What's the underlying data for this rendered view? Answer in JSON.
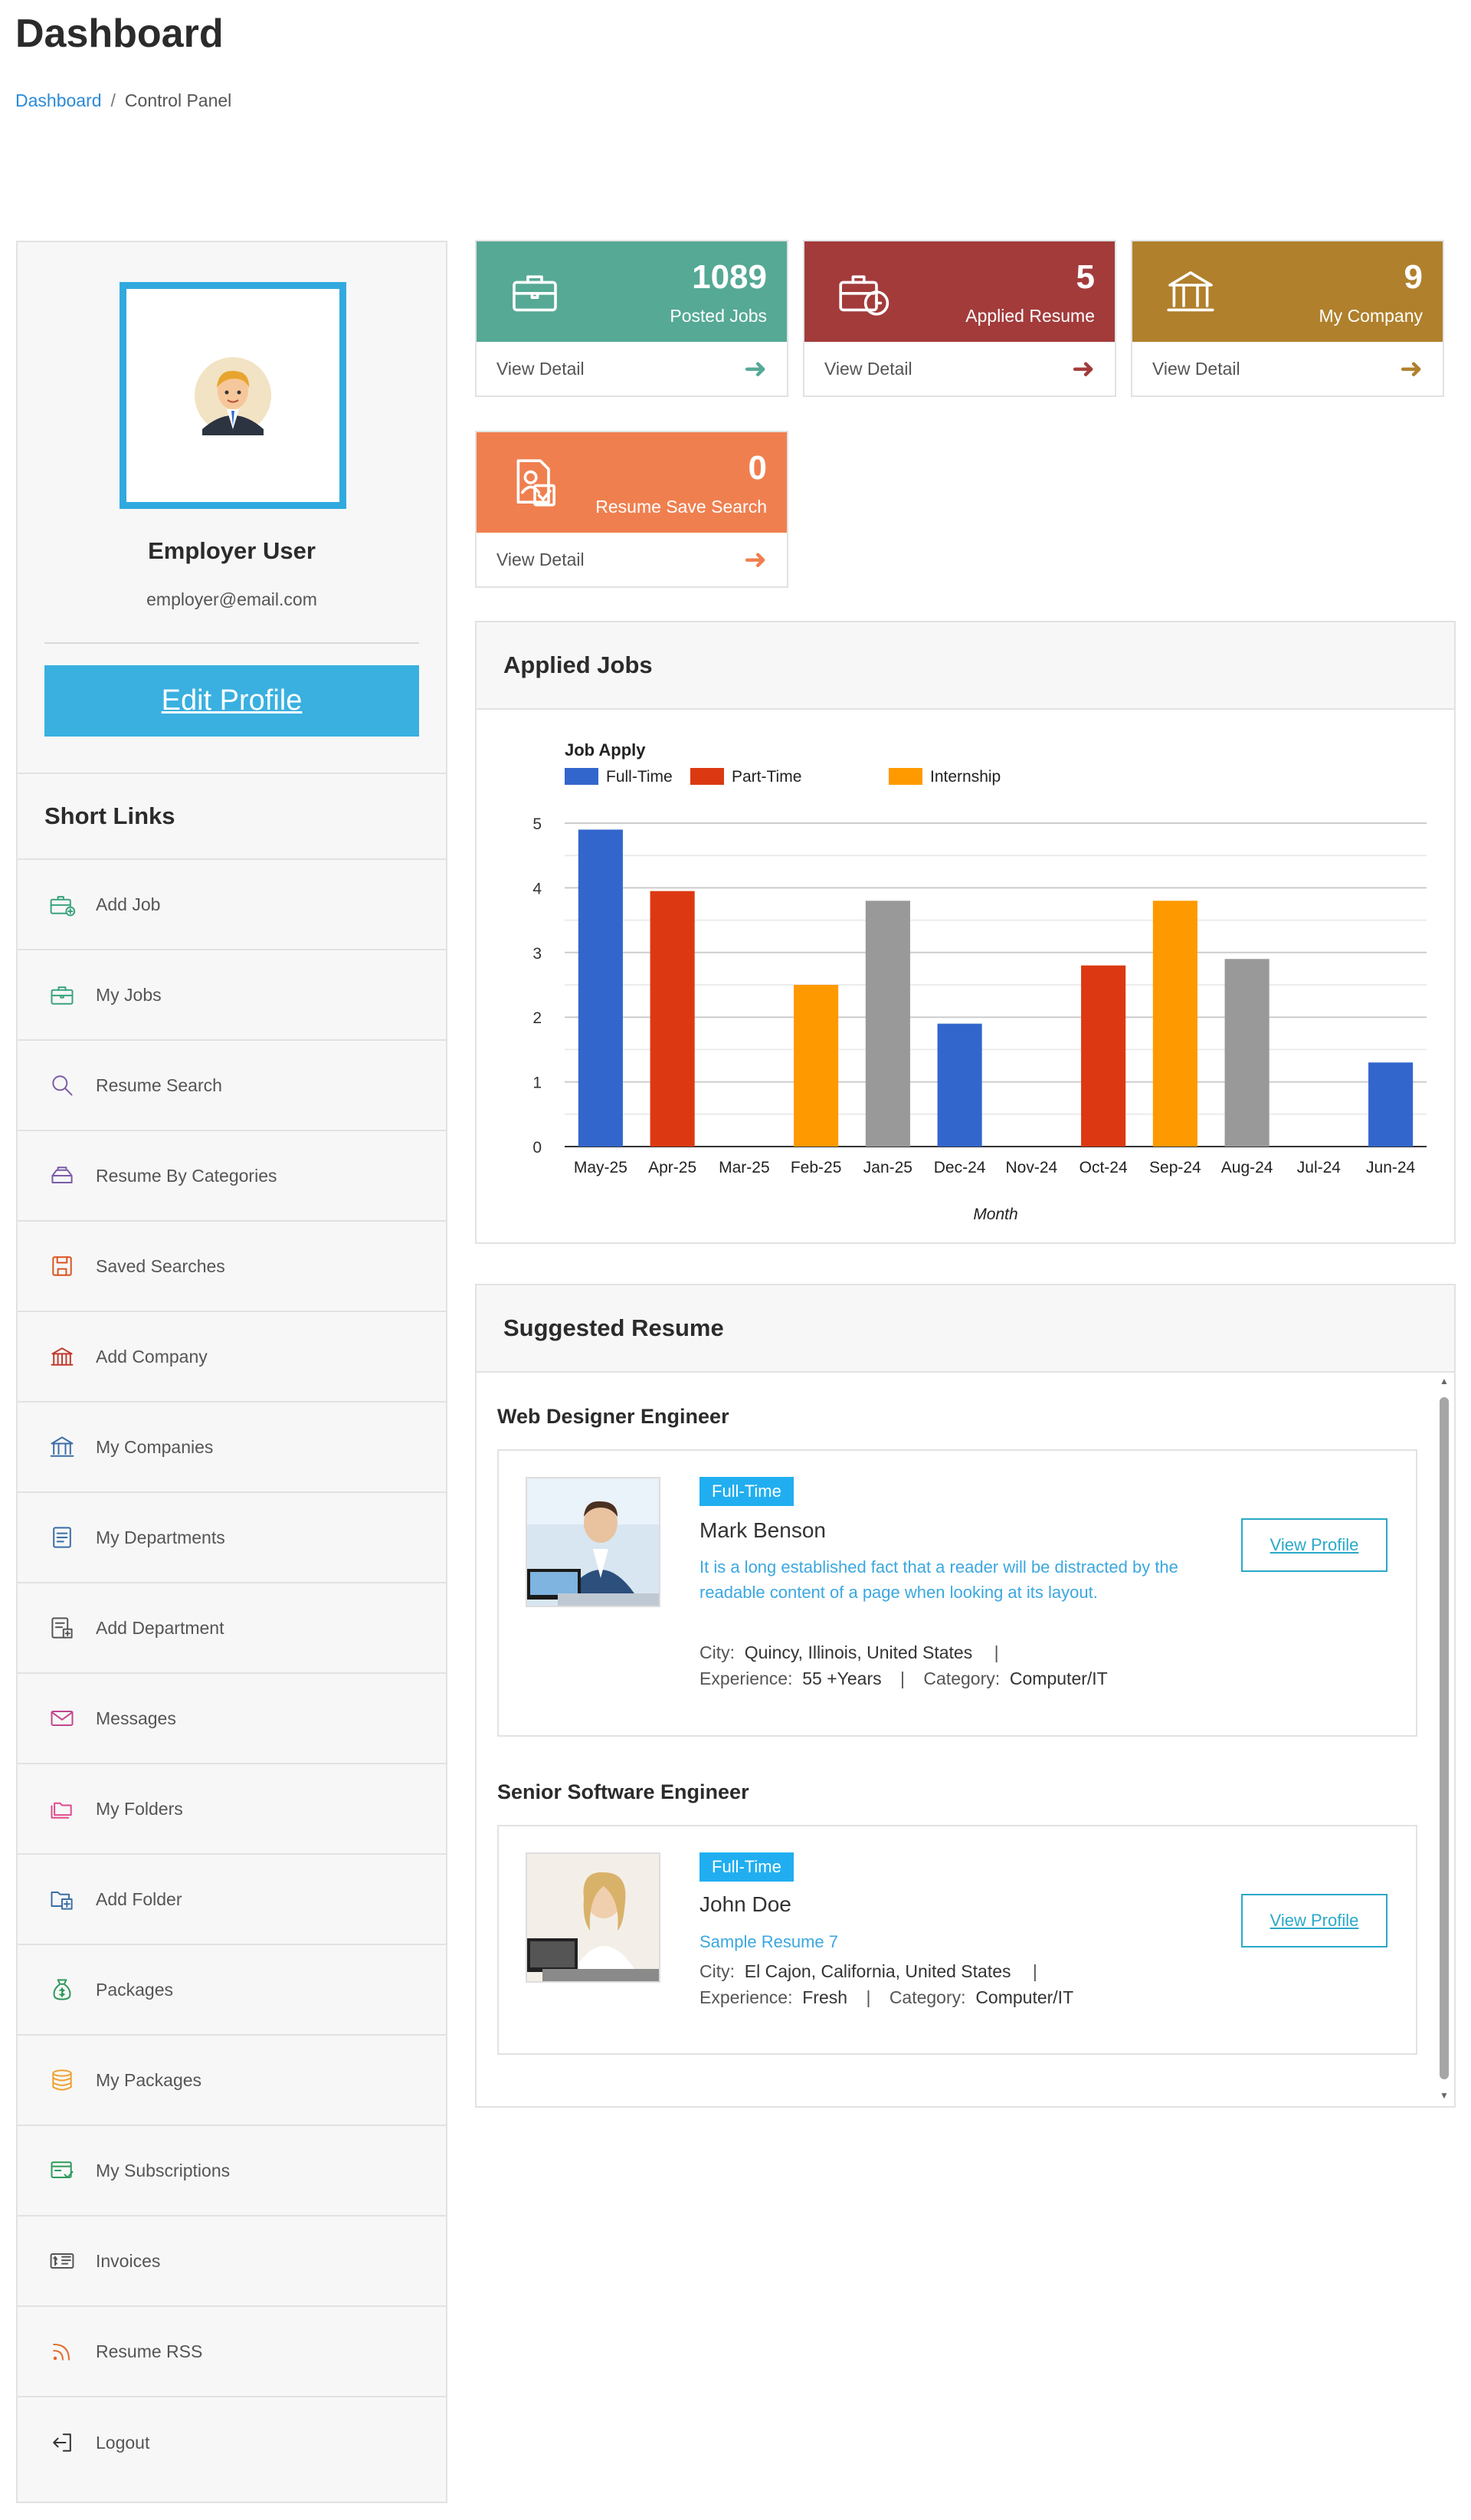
{
  "page": {
    "title": "Dashboard"
  },
  "breadcrumb": {
    "home": "Dashboard",
    "separator": "/",
    "current": "Control Panel"
  },
  "profile": {
    "name": "Employer User",
    "email": "employer@email.com",
    "edit_label": "Edit Profile"
  },
  "short_links": {
    "title": "Short Links",
    "items": [
      {
        "label": "Add Job",
        "icon": "briefcase-plus-icon",
        "color": "#3aa37c"
      },
      {
        "label": "My Jobs",
        "icon": "briefcase-icon",
        "color": "#3aa37c"
      },
      {
        "label": "Resume Search",
        "icon": "search-icon",
        "color": "#7a5ca8"
      },
      {
        "label": "Resume By Categories",
        "icon": "categories-icon",
        "color": "#7a5ca8"
      },
      {
        "label": "Saved Searches",
        "icon": "save-icon",
        "color": "#d9541e"
      },
      {
        "label": "Add Company",
        "icon": "company-add-icon",
        "color": "#c0392b"
      },
      {
        "label": "My Companies",
        "icon": "bank-icon",
        "color": "#3a6ea5"
      },
      {
        "label": "My Departments",
        "icon": "document-icon",
        "color": "#3a6ea5"
      },
      {
        "label": "Add Department",
        "icon": "document-add-icon",
        "color": "#555555"
      },
      {
        "label": "Messages",
        "icon": "mail-icon",
        "color": "#c0478e"
      },
      {
        "label": "My Folders",
        "icon": "folders-icon",
        "color": "#e24a8d"
      },
      {
        "label": "Add Folder",
        "icon": "folder-add-icon",
        "color": "#3a6ea5"
      },
      {
        "label": "Packages",
        "icon": "money-bag-icon",
        "color": "#2e9a5a"
      },
      {
        "label": "My Packages",
        "icon": "coins-icon",
        "color": "#f0a030"
      },
      {
        "label": "My Subscriptions",
        "icon": "subscription-icon",
        "color": "#2e9a5a"
      },
      {
        "label": "Invoices",
        "icon": "invoice-icon",
        "color": "#555555"
      },
      {
        "label": "Resume RSS",
        "icon": "rss-icon",
        "color": "#e26a2c"
      },
      {
        "label": "Logout",
        "icon": "logout-icon",
        "color": "#333333"
      }
    ]
  },
  "stats": [
    {
      "value": "1089",
      "label": "Posted Jobs",
      "link": "View Detail",
      "color": "#55a995",
      "icon": "briefcase-icon"
    },
    {
      "value": "5",
      "label": "Applied Resume",
      "link": "View Detail",
      "color": "#a33b3b",
      "icon": "briefcase-clock-icon"
    },
    {
      "value": "9",
      "label": "My Company",
      "link": "View Detail",
      "color": "#b0802c",
      "icon": "bank-icon"
    },
    {
      "value": "0",
      "label": "Resume Save Search",
      "link": "View Detail",
      "color": "#f07f4f",
      "icon": "resume-search-icon"
    }
  ],
  "applied_jobs": {
    "title": "Applied Jobs"
  },
  "chart_data": {
    "type": "bar",
    "title": "Job Apply",
    "xlabel": "Month",
    "ylabel": "",
    "ylim": [
      0,
      5
    ],
    "yticks": [
      0,
      1,
      2,
      3,
      4,
      5
    ],
    "grid": true,
    "legend": "top-left",
    "legend_entries": [
      {
        "name": "Full-Time",
        "color": "#3366cc"
      },
      {
        "name": "Part-Time",
        "color": "#dc3912"
      },
      {
        "name": "Internship",
        "color": "#ff9900"
      }
    ],
    "categories": [
      "May-25",
      "Apr-25",
      "Mar-25",
      "Feb-25",
      "Jan-25",
      "Dec-24",
      "Nov-24",
      "Oct-24",
      "Sep-24",
      "Aug-24",
      "Jul-24",
      "Jun-24"
    ],
    "values": [
      4.9,
      3.95,
      0,
      2.5,
      3.8,
      1.9,
      0,
      2.8,
      3.8,
      2.9,
      0,
      1.3
    ],
    "bars": [
      {
        "category": "May-25",
        "value": 4.9,
        "color": "#3366cc"
      },
      {
        "category": "Apr-25",
        "value": 3.95,
        "color": "#dc3912"
      },
      {
        "category": "Feb-25",
        "value": 2.5,
        "color": "#ff9900"
      },
      {
        "category": "Jan-25",
        "value": 3.8,
        "color": "#999999"
      },
      {
        "category": "Dec-24",
        "value": 1.9,
        "color": "#3366cc"
      },
      {
        "category": "Oct-24",
        "value": 2.8,
        "color": "#dc3912"
      },
      {
        "category": "Sep-24",
        "value": 3.8,
        "color": "#ff9900"
      },
      {
        "category": "Aug-24",
        "value": 2.9,
        "color": "#999999"
      },
      {
        "category": "Jun-24",
        "value": 1.3,
        "color": "#3366cc"
      }
    ]
  },
  "suggested": {
    "title": "Suggested Resume",
    "groups": [
      {
        "title": "Web Designer Engineer",
        "badge": "Full-Time",
        "name": "Mark Benson",
        "desc": "It is a long established fact that a reader will be distracted by the readable content of a page when looking at its layout.",
        "city_label": "City:",
        "city": "Quincy, Illinois, United States",
        "exp_label": "Experience:",
        "exp": "55 +Years",
        "cat_label": "Category:",
        "cat": "Computer/IT",
        "button": "View Profile"
      },
      {
        "title": "Senior Software Engineer",
        "badge": "Full-Time",
        "name": "John Doe",
        "desc": "Sample Resume 7",
        "city_label": "City:",
        "city": "El Cajon, California, United States",
        "exp_label": "Experience:",
        "exp": "Fresh",
        "cat_label": "Category:",
        "cat": "Computer/IT",
        "button": "View Profile"
      }
    ]
  }
}
